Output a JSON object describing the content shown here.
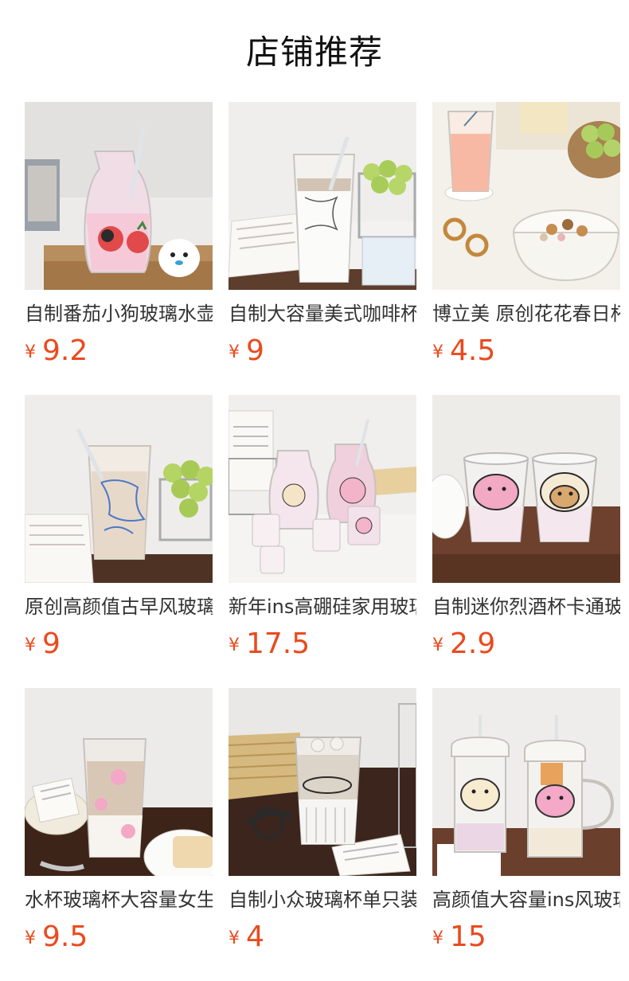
{
  "page": {
    "title": "店铺推荐"
  },
  "currency_symbol": "¥",
  "accent_color": "#ea4a1e",
  "products": [
    {
      "name": "自制番茄小狗玻璃水壶",
      "price": "9.2",
      "image": "pink-jug-with-dog-print-and-plush"
    },
    {
      "name": "自制大容量美式咖啡杯",
      "price": "9",
      "image": "map-print-glass-with-straw-and-grapes"
    },
    {
      "name": "博立美 原创花花春日杯",
      "price": "4.5",
      "image": "peach-drink-glass-with-yogurt-bowl"
    },
    {
      "name": "原创高颜值古早风玻璃杯",
      "price": "9",
      "image": "blue-doodle-glass-with-milk-tea"
    },
    {
      "name": "新年ins高硼硅家用玻璃壶",
      "price": "17.5",
      "image": "glass-set-with-pig-and-sheep-prints"
    },
    {
      "name": "自制迷你烈酒杯卡通玻璃杯",
      "price": "2.9",
      "image": "two-shot-glasses-pig-and-sheep"
    },
    {
      "name": "水杯玻璃杯大容量女生",
      "price": "9.5",
      "image": "pink-bear-latte-glass"
    },
    {
      "name": "自制小众玻璃杯单只装",
      "price": "4",
      "image": "ribbed-innocence-glass-with-sunglasses"
    },
    {
      "name": "高颜值大容量ins风玻璃杯",
      "price": "15",
      "image": "lidded-mugs-with-straws"
    }
  ]
}
